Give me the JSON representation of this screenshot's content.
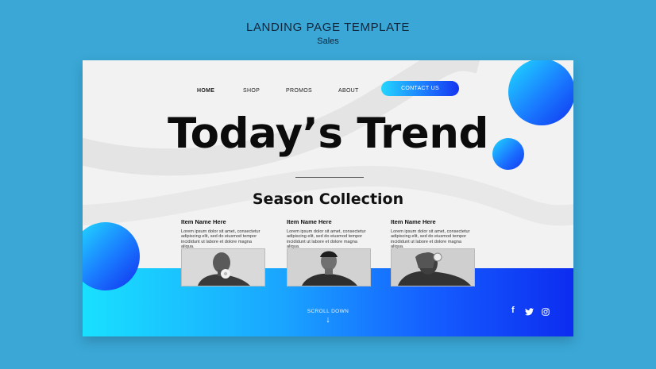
{
  "page": {
    "title": "LANDING PAGE TEMPLATE",
    "subtitle": "Sales"
  },
  "nav": {
    "home": "HOME",
    "shop": "SHOP",
    "promos": "PROMOS",
    "about": "ABOUT",
    "contact": "CONTACT US"
  },
  "hero": {
    "title": "Today’s Trend",
    "section_title": "Season Collection"
  },
  "items": [
    {
      "name": "Item Name Here",
      "description": "Lorem ipsum dolor sit amet, consectetur adipiscing elit, sed do eiusmod tempor incididunt ut labore et dolore magna aliqua."
    },
    {
      "name": "Item Name Here",
      "description": "Lorem ipsum dolor sit amet, consectetur adipiscing elit, sed do eiusmod tempor incididunt ut labore et dolore magna aliqua."
    },
    {
      "name": "Item Name Here",
      "description": "Lorem ipsum dolor sit amet, consectetur adipiscing elit, sed do eiusmod tempor incididunt ut labore et dolore magna aliqua."
    }
  ],
  "footer": {
    "scroll_label": "SCROLL DOWN",
    "scroll_icon": "arrow-down-icon",
    "social": [
      "facebook-icon",
      "twitter-icon",
      "instagram-icon"
    ]
  },
  "colors": {
    "background": "#3aa7d6",
    "card": "#f2f2f2",
    "gradient_start": "#19e0ff",
    "gradient_end": "#0d2cf0",
    "text_dark": "#0b0b0b"
  }
}
